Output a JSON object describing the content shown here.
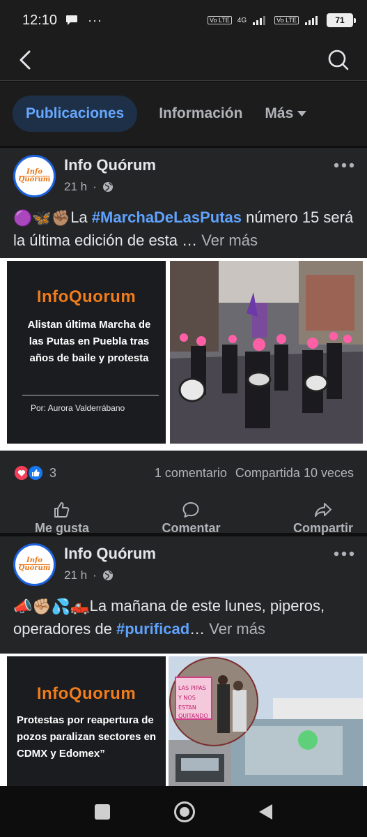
{
  "status_bar": {
    "time": "12:10",
    "more": "···",
    "volte_1": "Vo LTE",
    "network": "4G",
    "volte_2": "Vo LTE",
    "battery": "71"
  },
  "tabs": [
    {
      "label": "Publicaciones",
      "active": true
    },
    {
      "label": "Información",
      "active": false
    },
    {
      "label": "Más",
      "active": false
    }
  ],
  "posts": [
    {
      "page_name": "Info Quórum",
      "time": "21 h",
      "text_emojis": "🟣🦋✊🏽",
      "text_before": "La ",
      "hashtag": "#MarchaDeLasPutas",
      "text_after": " número 15 será la última edición de esta …",
      "see_more": "Ver más",
      "card": {
        "brand_a": "Info",
        "brand_b": "Quorum",
        "headline": "Alistan última Marcha de las Putas en Puebla tras años de baile y protesta",
        "author": "Por: Aurora Valderrábano"
      },
      "reaction_count": "3",
      "comments": "1 comentario",
      "shares": "Compartida 10 veces"
    },
    {
      "page_name": "Info Quórum",
      "time": "21 h",
      "text_emojis": "📣✊🏼💦🛻",
      "text_before": "La mañana de este lunes, piperos, operadores de ",
      "hashtag": "#purificad",
      "text_after": "…",
      "see_more": "Ver más",
      "card": {
        "brand_a": "Info",
        "brand_b": "Quorum",
        "headline": "Protestas por reapertura de pozos paralizan sectores en CDMX y Edomex”"
      },
      "sign_text": "LAS PIPAS Y NOS ESTAN QUITANDO"
    }
  ],
  "avatar": {
    "line1": "Info",
    "line2": "Quórum"
  },
  "actions": {
    "like": "Me gusta",
    "comment": "Comentar",
    "share": "Compartir"
  },
  "colors": {
    "accent": "#67a8ff",
    "hashtag": "#5fa3ff",
    "brand_orange": "#f07c1b",
    "card_bg": "#1b1c20"
  }
}
